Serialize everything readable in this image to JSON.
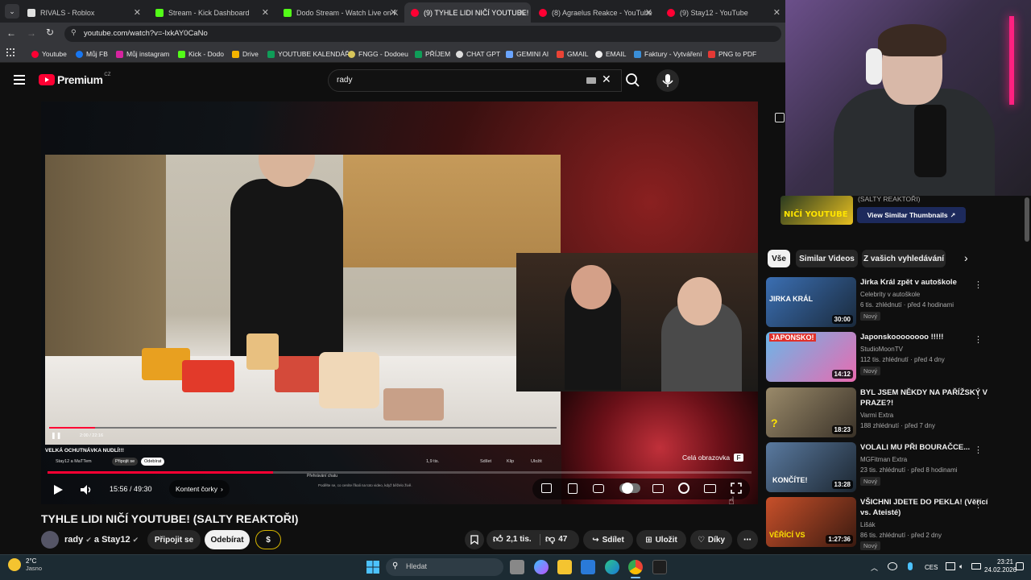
{
  "browser": {
    "tabs": [
      {
        "title": "RIVALS - Roblox",
        "active": false
      },
      {
        "title": "Stream - Kick Dashboard",
        "active": false
      },
      {
        "title": "Dodo Stream - Watch Live on K",
        "active": false
      },
      {
        "title": "(9) TYHLE LIDI NIČÍ YOUTUBE! (",
        "active": true
      },
      {
        "title": "(8) Agraelus Reakce - YouTube",
        "active": false
      },
      {
        "title": "(9) Stay12 - YouTube",
        "active": false
      }
    ],
    "url": "youtube.com/watch?v=-lxkAY0CaNo",
    "bookmarks": [
      "Youtube",
      "Můj FB",
      "Můj instagram",
      "Kick - Dodo",
      "Drive",
      "YOUTUBE KALENDÁŘ",
      "FNGG - Dodoeu",
      "PŘÍJEM",
      "CHAT GPT",
      "GEMINI AI",
      "GMAIL",
      "EMAIL",
      "Faktury - Vytváření",
      "PNG to PDF"
    ]
  },
  "youtube": {
    "logo_text": "Premium",
    "logo_region": "CZ",
    "search_value": "rady"
  },
  "player": {
    "time_current": "15:56",
    "time_total": "49:30",
    "time_display": "15:56 / 49:30",
    "chapter_label": "Kontent čorky",
    "fullscreen_tooltip": "Celá obrazovka",
    "fullscreen_key": "F",
    "progress_fraction": 0.32,
    "inner": {
      "title": "VELKÁ OCHUTNÁVKA NUDLÍ!!!",
      "channel": "Stay12 a MaTTem",
      "subscribe": "Odebírat",
      "join": "Připojit se",
      "likes": "1,9 tis.",
      "share": "Sdílet",
      "clip": "Klip",
      "save": "Uložit",
      "time": "2:00 / 22:16",
      "chat_label": "Přehrávání chatu",
      "chat_text": "Podělte se, co ceníte říkali na toto video, když běželo živě."
    }
  },
  "video": {
    "title": "TYHLE LIDI NIČÍ YOUTUBE! (SALTY REAKTOŘI)",
    "channel": "rady",
    "channel_and": "a Stay12",
    "join_label": "Připojit se",
    "subscribe_label": "Odebírat",
    "thanks_symbol": "$",
    "likes": "2,1 tis.",
    "dislikes": "47",
    "share_label": "Sdílet",
    "save_label": "Uložit",
    "thanks_label": "Díky"
  },
  "sidebar": {
    "top_video_title_partial": "(SALTY REAKTOŘI)",
    "thumbnail_text": "NIČÍ YOUTUBE",
    "view_thumbnails": "View Similar Thumbnails",
    "filters": [
      "Vše",
      "Similar Videos",
      "Z vašich vyhledávání"
    ],
    "items": [
      {
        "title": "Jirka Král zpět v autoškole",
        "channel": "Celebrity v autoškole",
        "meta": "6 tis. zhlédnutí · před 4 hodinami",
        "badge": "Nový",
        "duration": "30:00",
        "thumb_text": "JIRKA KRÁL",
        "color1": "#3b6fb3",
        "color2": "#1a2a3c"
      },
      {
        "title": "Japonskoooooooo !!!!!",
        "channel": "StudioMoonTV",
        "meta": "112 tis. zhlédnutí · před 4 dny",
        "badge": "Nový",
        "duration": "14:12",
        "thumb_text": "JAPONSKO!",
        "color1": "#6bb6e8",
        "color2": "#e86bb0"
      },
      {
        "title": "BYL JSEM NĚKDY NA PAŘÍŽSKÝ V PRAZE?!",
        "channel": "Varmi Extra",
        "meta": "188 zhlédnutí · před 7 dny",
        "badge": "",
        "duration": "18:23",
        "thumb_text": "?",
        "color1": "#9a8a6a",
        "color2": "#3a3228"
      },
      {
        "title": "VOLALI MU PŘI BOURAČCE...",
        "channel": "MGFitman Extra",
        "meta": "23 tis. zhlédnutí · před 8 hodinami",
        "badge": "Nový",
        "duration": "13:28",
        "thumb_text": "KONČÍTE!",
        "color1": "#5a7aa0",
        "color2": "#1c2630"
      },
      {
        "title": "VŠICHNI JDETE DO PEKLA! (Věřící vs. Ateisté)",
        "channel": "Lišák",
        "meta": "86 tis. zhlédnutí · před 2 dny",
        "badge": "Nový",
        "duration": "1:27:36",
        "thumb_text": "VĚŘÍCÍ VS",
        "color1": "#c8502a",
        "color2": "#3a1a10"
      }
    ]
  },
  "taskbar": {
    "weather_temp": "2°C",
    "weather_text": "Jasno",
    "search_placeholder": "Hledat",
    "lang": "CES",
    "time": "23:21",
    "date": "24.02.2026"
  }
}
